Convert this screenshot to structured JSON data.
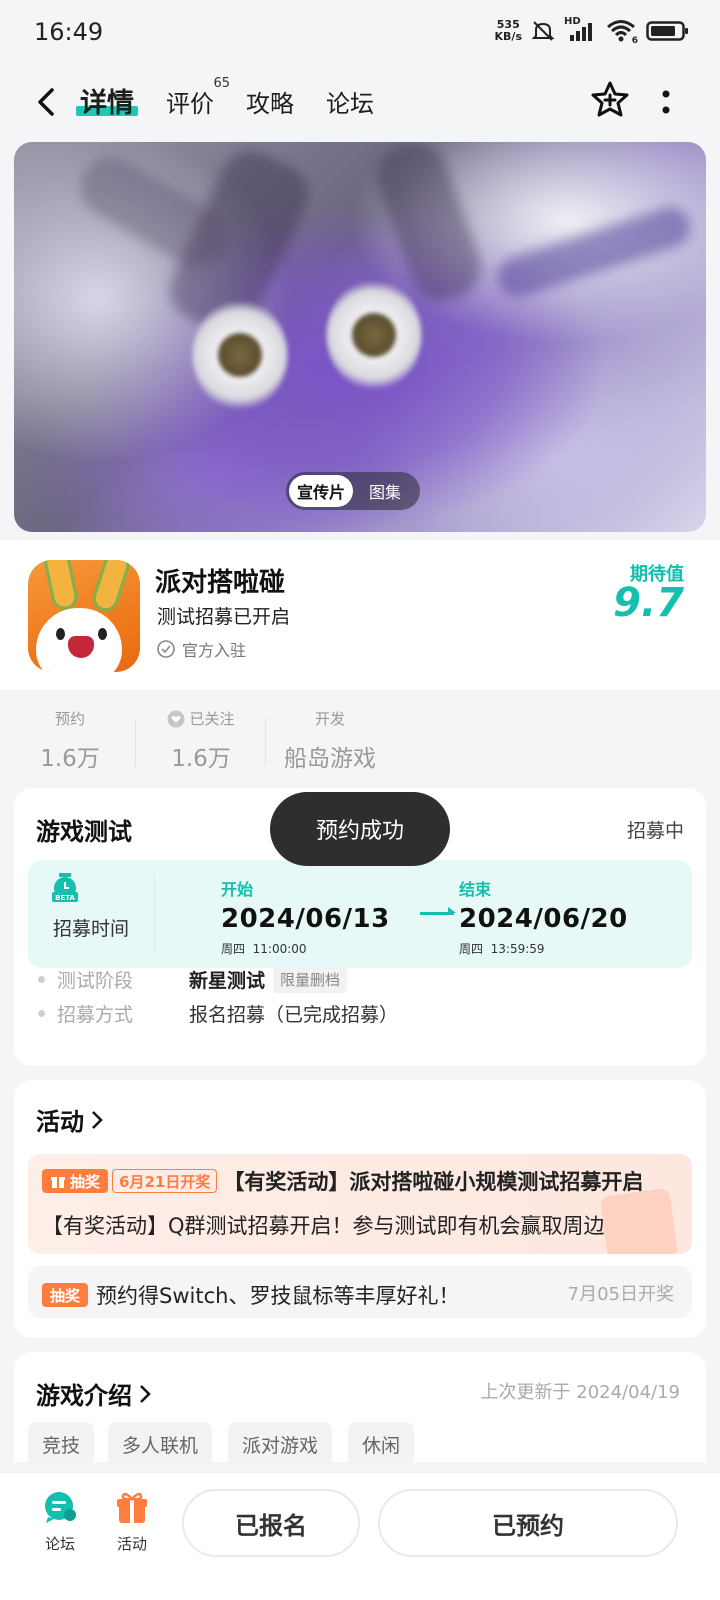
{
  "status_bar": {
    "time": "16:49",
    "net_speed_value": "535",
    "net_speed_unit": "KB/s",
    "hd_label": "HD",
    "wifi_sub": "6"
  },
  "nav": {
    "tabs": [
      {
        "label": "详情",
        "active": true
      },
      {
        "label": "评价",
        "badge": "65"
      },
      {
        "label": "攻略"
      },
      {
        "label": "论坛"
      }
    ],
    "icons": [
      "back-icon",
      "star-plus-icon",
      "more-vertical-icon"
    ]
  },
  "banner": {
    "switch": [
      "宣传片",
      "图集"
    ],
    "selected": "宣传片"
  },
  "game": {
    "name": "派对搭啦碰",
    "subtitle": "测试招募已开启",
    "official": "官方入驻",
    "expect_label": "期待值",
    "expect_score": "9.7"
  },
  "stats": [
    {
      "label": "预约",
      "value": "1.6万"
    },
    {
      "label": "已关注",
      "value": "1.6万"
    },
    {
      "label": "开发",
      "value": "船岛游戏"
    }
  ],
  "test": {
    "title": "游戏测试",
    "status": "招募中",
    "recruit_label": "招募时间",
    "start": {
      "heading": "开始",
      "date": "2024/06/13",
      "weekday": "周四",
      "time": "11:00:00"
    },
    "end": {
      "heading": "结束",
      "date": "2024/06/20",
      "weekday": "周四",
      "time": "13:59:59"
    },
    "rows": [
      {
        "key": "测试阶段",
        "value": "新星测试",
        "tag": "限量删档"
      },
      {
        "key": "招募方式",
        "value": "报名招募（已完成招募）"
      }
    ]
  },
  "toast": "预约成功",
  "activity": {
    "title": "活动",
    "items": [
      {
        "badge": "抽奖",
        "date_badge": "6月21日开奖",
        "title": "【有奖活动】派对搭啦碰小规模测试招募开启",
        "desc": "【有奖活动】Q群测试招募开启！参与测试即有机会赢取周边"
      },
      {
        "badge": "抽奖",
        "title": "预约得Switch、罗技鼠标等丰厚好礼！",
        "date": "7月05日开奖"
      }
    ]
  },
  "intro": {
    "title": "游戏介绍",
    "updated": "上次更新于 2024/04/19",
    "tags": [
      "竞技",
      "多人联机",
      "派对游戏",
      "休闲"
    ]
  },
  "bottom": {
    "forum": "论坛",
    "activity": "活动",
    "signed_up": "已报名",
    "reserved": "已预约"
  },
  "colors": {
    "accent": "#13bfae",
    "orange": "#ff7d3e",
    "toast_bg": "#2e2e2e"
  }
}
